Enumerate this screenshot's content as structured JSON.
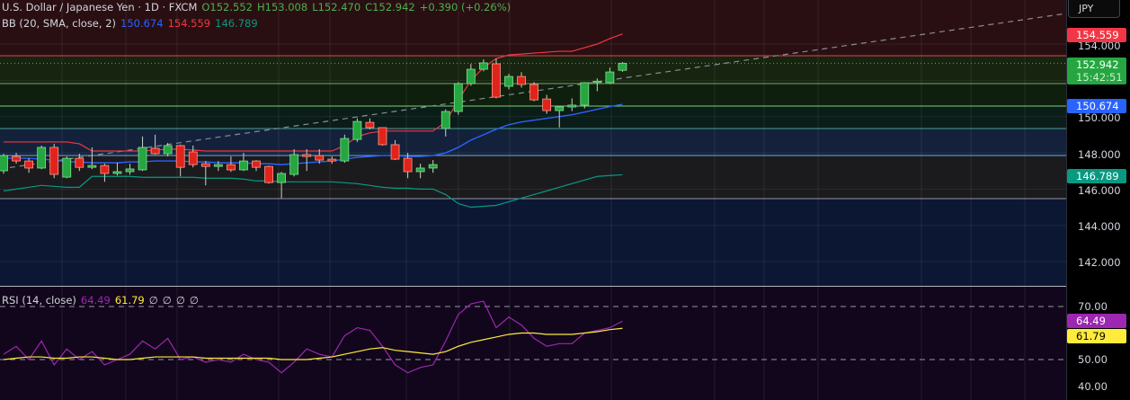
{
  "header": {
    "symbol": "U.S. Dollar / Japanese Yen · 1D · FXCM",
    "open": "O152.552",
    "high": "H153.008",
    "low": "L152.470",
    "close": "C152.942",
    "change": "+0.390 (+0.26%)"
  },
  "bb": {
    "label": "BB (20, SMA, close, 2)",
    "basis": "150.674",
    "upper": "154.559",
    "lower": "146.789"
  },
  "rsi": {
    "label": "RSI (14, close)",
    "value": "64.49",
    "ma": "61.79",
    "empties": [
      "∅",
      "∅",
      "∅",
      "∅"
    ]
  },
  "currency_button": "JPY",
  "price_axis": {
    "ticks": [
      "154.000",
      "150.000",
      "148.000",
      "146.000",
      "144.000",
      "142.000"
    ],
    "tick_values": [
      154,
      150,
      148,
      146,
      144,
      142
    ],
    "badges": {
      "upper": "154.559",
      "last": "152.942",
      "countdown": "15:42:51",
      "basis": "150.674",
      "lower": "146.789"
    }
  },
  "rsi_axis": {
    "ticks": [
      "70.00",
      "50.00",
      "40.00"
    ],
    "tick_values": [
      70,
      50,
      40
    ],
    "rsi_badge": "64.49",
    "ma_badge": "61.79"
  },
  "colors": {
    "up": "#26a641",
    "down": "#e0241b",
    "basis": "#2962ff",
    "upper": "#f23645",
    "lower": "#089981",
    "rsi": "#9c27b0",
    "rsi_ma": "#ffeb3b"
  },
  "chart_data": {
    "type": "candlestick",
    "ylim": [
      140.6,
      155.0
    ],
    "candles": [
      [
        147.01,
        147.95,
        146.85,
        147.85
      ],
      [
        147.8,
        148.0,
        147.4,
        147.55
      ],
      [
        147.55,
        147.7,
        146.9,
        147.16
      ],
      [
        147.16,
        148.4,
        147.1,
        148.3
      ],
      [
        148.3,
        148.5,
        146.6,
        146.81
      ],
      [
        146.66,
        147.8,
        146.6,
        147.7
      ],
      [
        147.7,
        147.95,
        147.0,
        147.2
      ],
      [
        147.2,
        148.3,
        147.1,
        147.3
      ],
      [
        147.3,
        147.4,
        146.4,
        146.86
      ],
      [
        146.86,
        147.45,
        146.75,
        146.96
      ],
      [
        146.96,
        147.4,
        146.8,
        147.11
      ],
      [
        147.06,
        148.9,
        147.0,
        148.3
      ],
      [
        148.25,
        149.0,
        147.9,
        147.95
      ],
      [
        147.95,
        148.55,
        147.8,
        148.4
      ],
      [
        148.4,
        148.45,
        146.7,
        147.2
      ],
      [
        148.05,
        148.4,
        147.2,
        147.35
      ],
      [
        147.4,
        147.55,
        146.2,
        147.25
      ],
      [
        147.25,
        147.55,
        147.0,
        147.35
      ],
      [
        147.35,
        147.8,
        146.95,
        147.06
      ],
      [
        147.06,
        148.0,
        147.0,
        147.55
      ],
      [
        147.55,
        147.6,
        147.0,
        147.2
      ],
      [
        147.25,
        147.3,
        146.3,
        146.36
      ],
      [
        146.36,
        146.95,
        145.5,
        146.86
      ],
      [
        146.81,
        148.2,
        146.7,
        147.9
      ],
      [
        147.9,
        148.2,
        147.0,
        147.8
      ],
      [
        147.85,
        148.2,
        147.4,
        147.6
      ],
      [
        147.65,
        147.8,
        147.4,
        147.55
      ],
      [
        147.55,
        149.0,
        147.45,
        148.79
      ],
      [
        148.74,
        149.9,
        148.6,
        149.73
      ],
      [
        149.68,
        149.9,
        149.3,
        149.39
      ],
      [
        149.39,
        149.4,
        148.4,
        148.45
      ],
      [
        148.45,
        148.7,
        147.6,
        147.65
      ],
      [
        147.7,
        148.0,
        146.6,
        146.96
      ],
      [
        146.96,
        147.4,
        146.6,
        147.16
      ],
      [
        147.16,
        147.6,
        146.9,
        147.35
      ],
      [
        149.34,
        150.4,
        148.9,
        150.28
      ],
      [
        150.28,
        151.9,
        150.1,
        151.82
      ],
      [
        151.82,
        152.9,
        151.7,
        152.61
      ],
      [
        152.61,
        153.15,
        152.5,
        152.96
      ],
      [
        152.91,
        153.2,
        151.0,
        151.07
      ],
      [
        151.67,
        152.35,
        151.5,
        152.21
      ],
      [
        152.21,
        152.45,
        151.6,
        151.77
      ],
      [
        151.77,
        151.9,
        150.85,
        150.92
      ],
      [
        150.97,
        151.2,
        150.15,
        150.33
      ],
      [
        150.33,
        150.55,
        149.4,
        150.53
      ],
      [
        150.53,
        151.0,
        150.3,
        150.63
      ],
      [
        150.63,
        151.9,
        150.45,
        151.87
      ],
      [
        151.92,
        152.1,
        151.4,
        151.95
      ],
      [
        151.87,
        152.7,
        151.8,
        152.46
      ],
      [
        152.552,
        153.008,
        152.47,
        152.942
      ]
    ],
    "bb_upper": [
      148.6,
      148.6,
      148.6,
      148.6,
      148.6,
      148.6,
      148.5,
      148.1,
      148.1,
      148.1,
      148.1,
      148.1,
      148.15,
      148.2,
      148.2,
      148.15,
      148.1,
      148.1,
      148.1,
      148.1,
      148.1,
      148.1,
      148.1,
      148.1,
      148.1,
      148.1,
      148.1,
      148.4,
      148.9,
      149.1,
      149.2,
      149.2,
      149.2,
      149.2,
      149.2,
      149.7,
      150.9,
      152.0,
      152.7,
      153.2,
      153.4,
      153.45,
      153.5,
      153.55,
      153.6,
      153.6,
      153.8,
      154.0,
      154.3,
      154.559
    ],
    "bb_basis": [
      147.7,
      147.7,
      147.7,
      147.65,
      147.6,
      147.5,
      147.5,
      147.45,
      147.45,
      147.45,
      147.5,
      147.5,
      147.55,
      147.55,
      147.55,
      147.5,
      147.5,
      147.45,
      147.45,
      147.45,
      147.4,
      147.4,
      147.35,
      147.4,
      147.45,
      147.5,
      147.55,
      147.65,
      147.75,
      147.8,
      147.85,
      147.85,
      147.8,
      147.8,
      147.85,
      148.0,
      148.3,
      148.7,
      149.0,
      149.3,
      149.55,
      149.7,
      149.8,
      149.9,
      150.0,
      150.1,
      150.25,
      150.4,
      150.55,
      150.674
    ],
    "bb_lower": [
      145.9,
      146.0,
      146.1,
      146.2,
      146.15,
      146.1,
      146.1,
      146.7,
      146.7,
      146.7,
      146.7,
      146.65,
      146.65,
      146.65,
      146.65,
      146.65,
      146.6,
      146.6,
      146.6,
      146.55,
      146.45,
      146.45,
      146.4,
      146.4,
      146.4,
      146.4,
      146.4,
      146.35,
      146.3,
      146.2,
      146.1,
      146.05,
      146.05,
      146.0,
      146.0,
      145.7,
      145.2,
      145.0,
      145.05,
      145.1,
      145.3,
      145.5,
      145.7,
      145.9,
      146.1,
      146.3,
      146.5,
      146.7,
      146.75,
      146.789
    ],
    "rsi": [
      52,
      55,
      50,
      57,
      48,
      54,
      50,
      53,
      48,
      50,
      52,
      57,
      54,
      58,
      50,
      51,
      49,
      50,
      49,
      52,
      50,
      49,
      45,
      49,
      54,
      52,
      51,
      59,
      62,
      61,
      55,
      48,
      45,
      47,
      48,
      57,
      67,
      71,
      72,
      62,
      66,
      63,
      58,
      55,
      56,
      56,
      60,
      61,
      62,
      64.49
    ],
    "rsi_ma": [
      50,
      50.5,
      51,
      51,
      50.5,
      50.5,
      51,
      51,
      50.5,
      50,
      50,
      50.5,
      51,
      51,
      51,
      51,
      50.5,
      50.5,
      50.5,
      50.5,
      50.5,
      50.5,
      50,
      50,
      50,
      50.5,
      51,
      52,
      53,
      54,
      54.5,
      53.5,
      53,
      52.5,
      52,
      53,
      55,
      56.5,
      57.5,
      58.5,
      59.5,
      60,
      60,
      59.5,
      59.5,
      59.5,
      60,
      60.5,
      61.3,
      61.79
    ],
    "rsi_levels": [
      70,
      50
    ]
  }
}
